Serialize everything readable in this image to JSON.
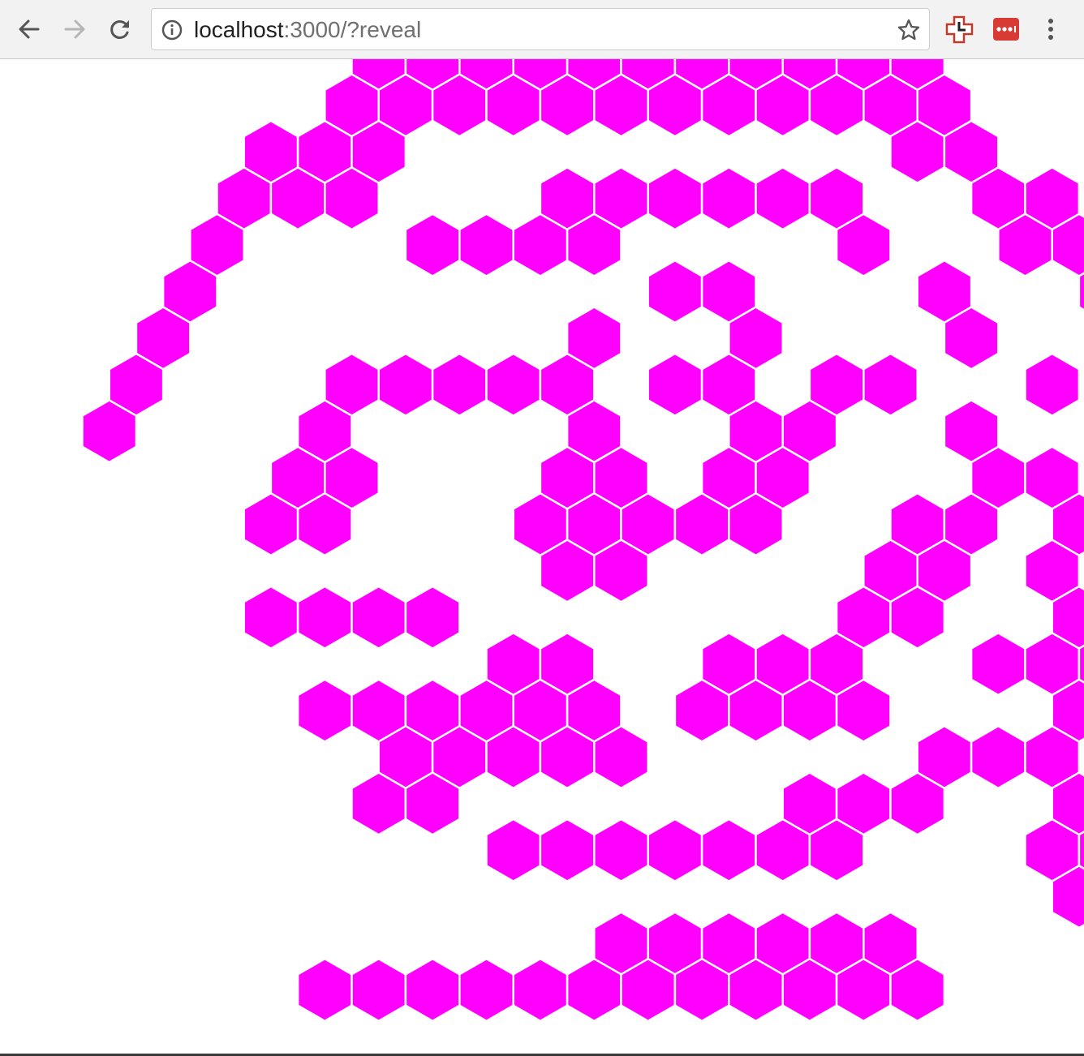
{
  "browser": {
    "url_host": "localhost",
    "url_rest": ":3000/?reveal"
  },
  "icons": {
    "back": "arrow-left-icon",
    "forward": "arrow-right-icon",
    "reload": "reload-icon",
    "info": "info-icon",
    "bookmark": "star-icon",
    "extension_1": "red-cross-clock-icon",
    "extension_2": "lastpass-icon",
    "menu": "kebab-menu-icon"
  },
  "colors": {
    "cell_fill": "#ff00ff",
    "cell_edge": "#ffffff",
    "current_outline": "#000000",
    "toolbar": "#f2f2f2"
  },
  "maze": {
    "current_cell": "r12c2",
    "rows": [
      "......XXXXXXXXXXX.....",
      ".....XXXXXXXXXXXX.....",
      "....XXX.........XX....",
      "...XXX...XXXXXX..XX...",
      "...X...XXXX....X..XX..",
      "..X........XX...X..XX.",
      "..X.......X..X...X..XX",
      ".X...XXXXX.XX.XX..X.XX",
      ".X...X....X..XX..X...X",
      "....XX...XX.XX...XX..X",
      "....XX...XXXXX..XX.XX.",
      ".........XX....XX.X.XX",
      "....XXXX.......XX..XXX",
      "........XX..XXX..XXX..",
      ".....XXXXXX.XXXX...XX.",
      "......XXXXX.....XXX.XX",
      "......XX......XXX..XX.",
      "........XXXXXXX...XX..",
      "...................XX.",
      "..........XXXXXX......",
      ".....XXXXXXXXXXXX....."
    ]
  }
}
